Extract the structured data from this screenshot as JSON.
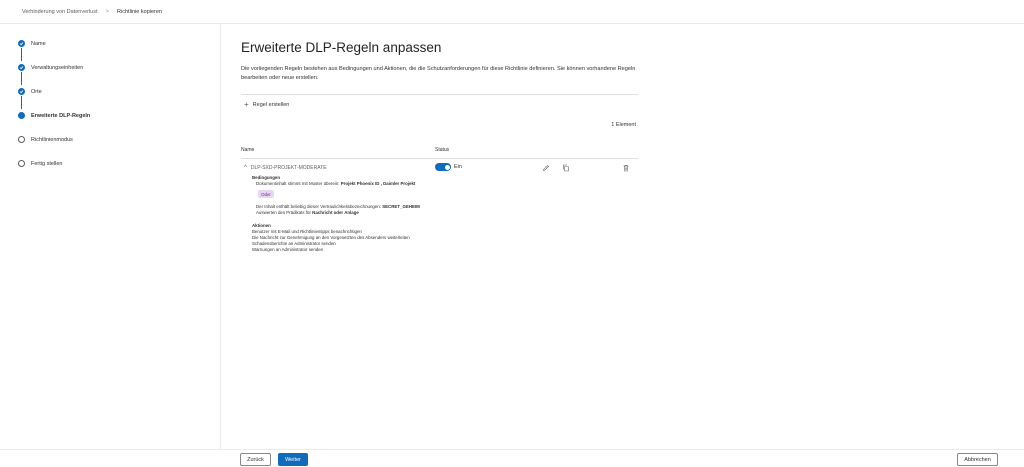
{
  "breadcrumb": {
    "parent": "Verhinderung von Datenverlust",
    "separator": ">",
    "current": "Richtlinie kopieren"
  },
  "wizard": {
    "steps": [
      {
        "label": "Name",
        "state": "done"
      },
      {
        "label": "Verwaltungseinheiten",
        "state": "done"
      },
      {
        "label": "Orte",
        "state": "done"
      },
      {
        "label": "Erweiterte DLP-Regeln",
        "state": "current"
      },
      {
        "label": "Richtlinienmodus",
        "state": "todo"
      },
      {
        "label": "Fertig stellen",
        "state": "todo"
      }
    ]
  },
  "main": {
    "title": "Erweiterte DLP-Regeln anpassen",
    "description": "Die vorliegenden Regeln bestehen aus Bedingungen und Aktionen, die die Schutzanforderungen für diese Richtlinie definieren. Sie können vorhandene Regeln bearbeiten oder neue erstellen.",
    "create_rule_label": "Regel erstellen",
    "item_count": "1 Element",
    "columns": {
      "name": "Name",
      "status": "Status"
    }
  },
  "rule": {
    "name": "DLP-SXD-PROJEKT-MODERATE",
    "status_label": "Ein",
    "status_on": true,
    "conditions_heading": "Bedingungen",
    "condition1_prefix": "Dokumentinhalt stimmt mit Muster überein:",
    "condition1_value": "Projekt Phoenix ID , Daimler Projekt",
    "or_label": "Oder",
    "condition2_prefix": "Der Inhalt enthält beliebig dieser Vertraulichkeitsbezeichnungen:",
    "condition2_value": "SECRET_GEHEIM",
    "condition3_prefix": "Auswerten des Prädikats für",
    "condition3_value": "Nachricht oder Anlage",
    "actions_heading": "Aktionen",
    "actions": [
      "Benutzer mit E-Mail und Richtlinientipps benachrichtigen",
      "Die Nachricht zur Genehmigung an den Vorgesetzten des Absenders weiterleiten",
      "Schadensberichte an Administrator senden",
      "Warnungen an Administrator senden"
    ]
  },
  "footer": {
    "back_label": "Zurück",
    "next_label": "Weiter",
    "cancel_label": "Abbrechen"
  }
}
